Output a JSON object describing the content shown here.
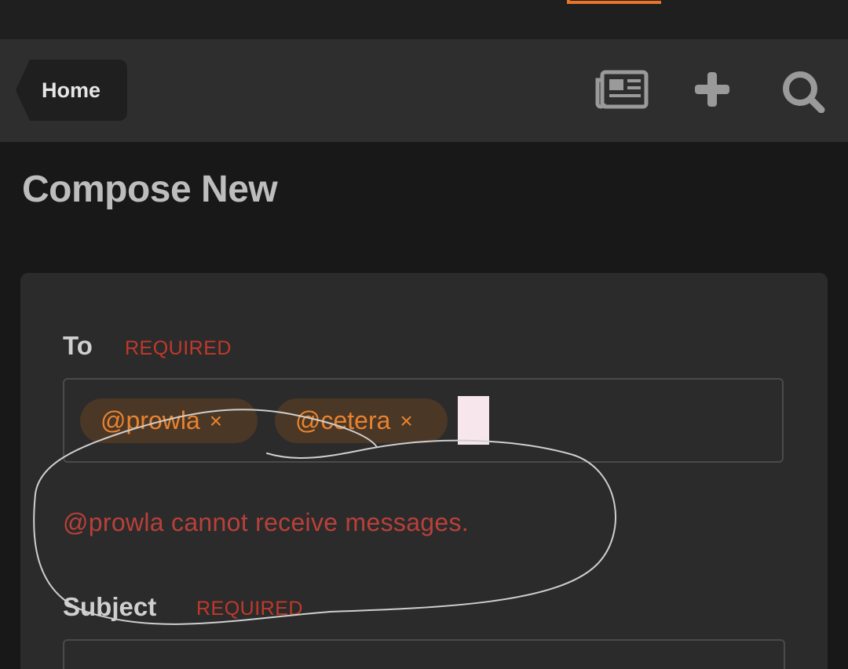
{
  "nav": {
    "home_label": "Home",
    "icons": [
      "newspaper-icon",
      "plus-icon",
      "search-icon"
    ]
  },
  "page": {
    "title": "Compose New"
  },
  "form": {
    "to": {
      "label": "To",
      "required_label": "REQUIRED",
      "recipients": [
        {
          "handle": "@prowla",
          "remove": "×"
        },
        {
          "handle": "@cetera",
          "remove": "×"
        }
      ],
      "error": "@prowla cannot receive messages."
    },
    "subject": {
      "label": "Subject",
      "required_label": "REQUIRED",
      "value": ""
    }
  },
  "colors": {
    "background": "#181818",
    "navbar": "#2e2e2e",
    "card": "#2b2b2b",
    "accent": "#e8832f",
    "error": "#b8403a",
    "required": "#c0392b"
  }
}
